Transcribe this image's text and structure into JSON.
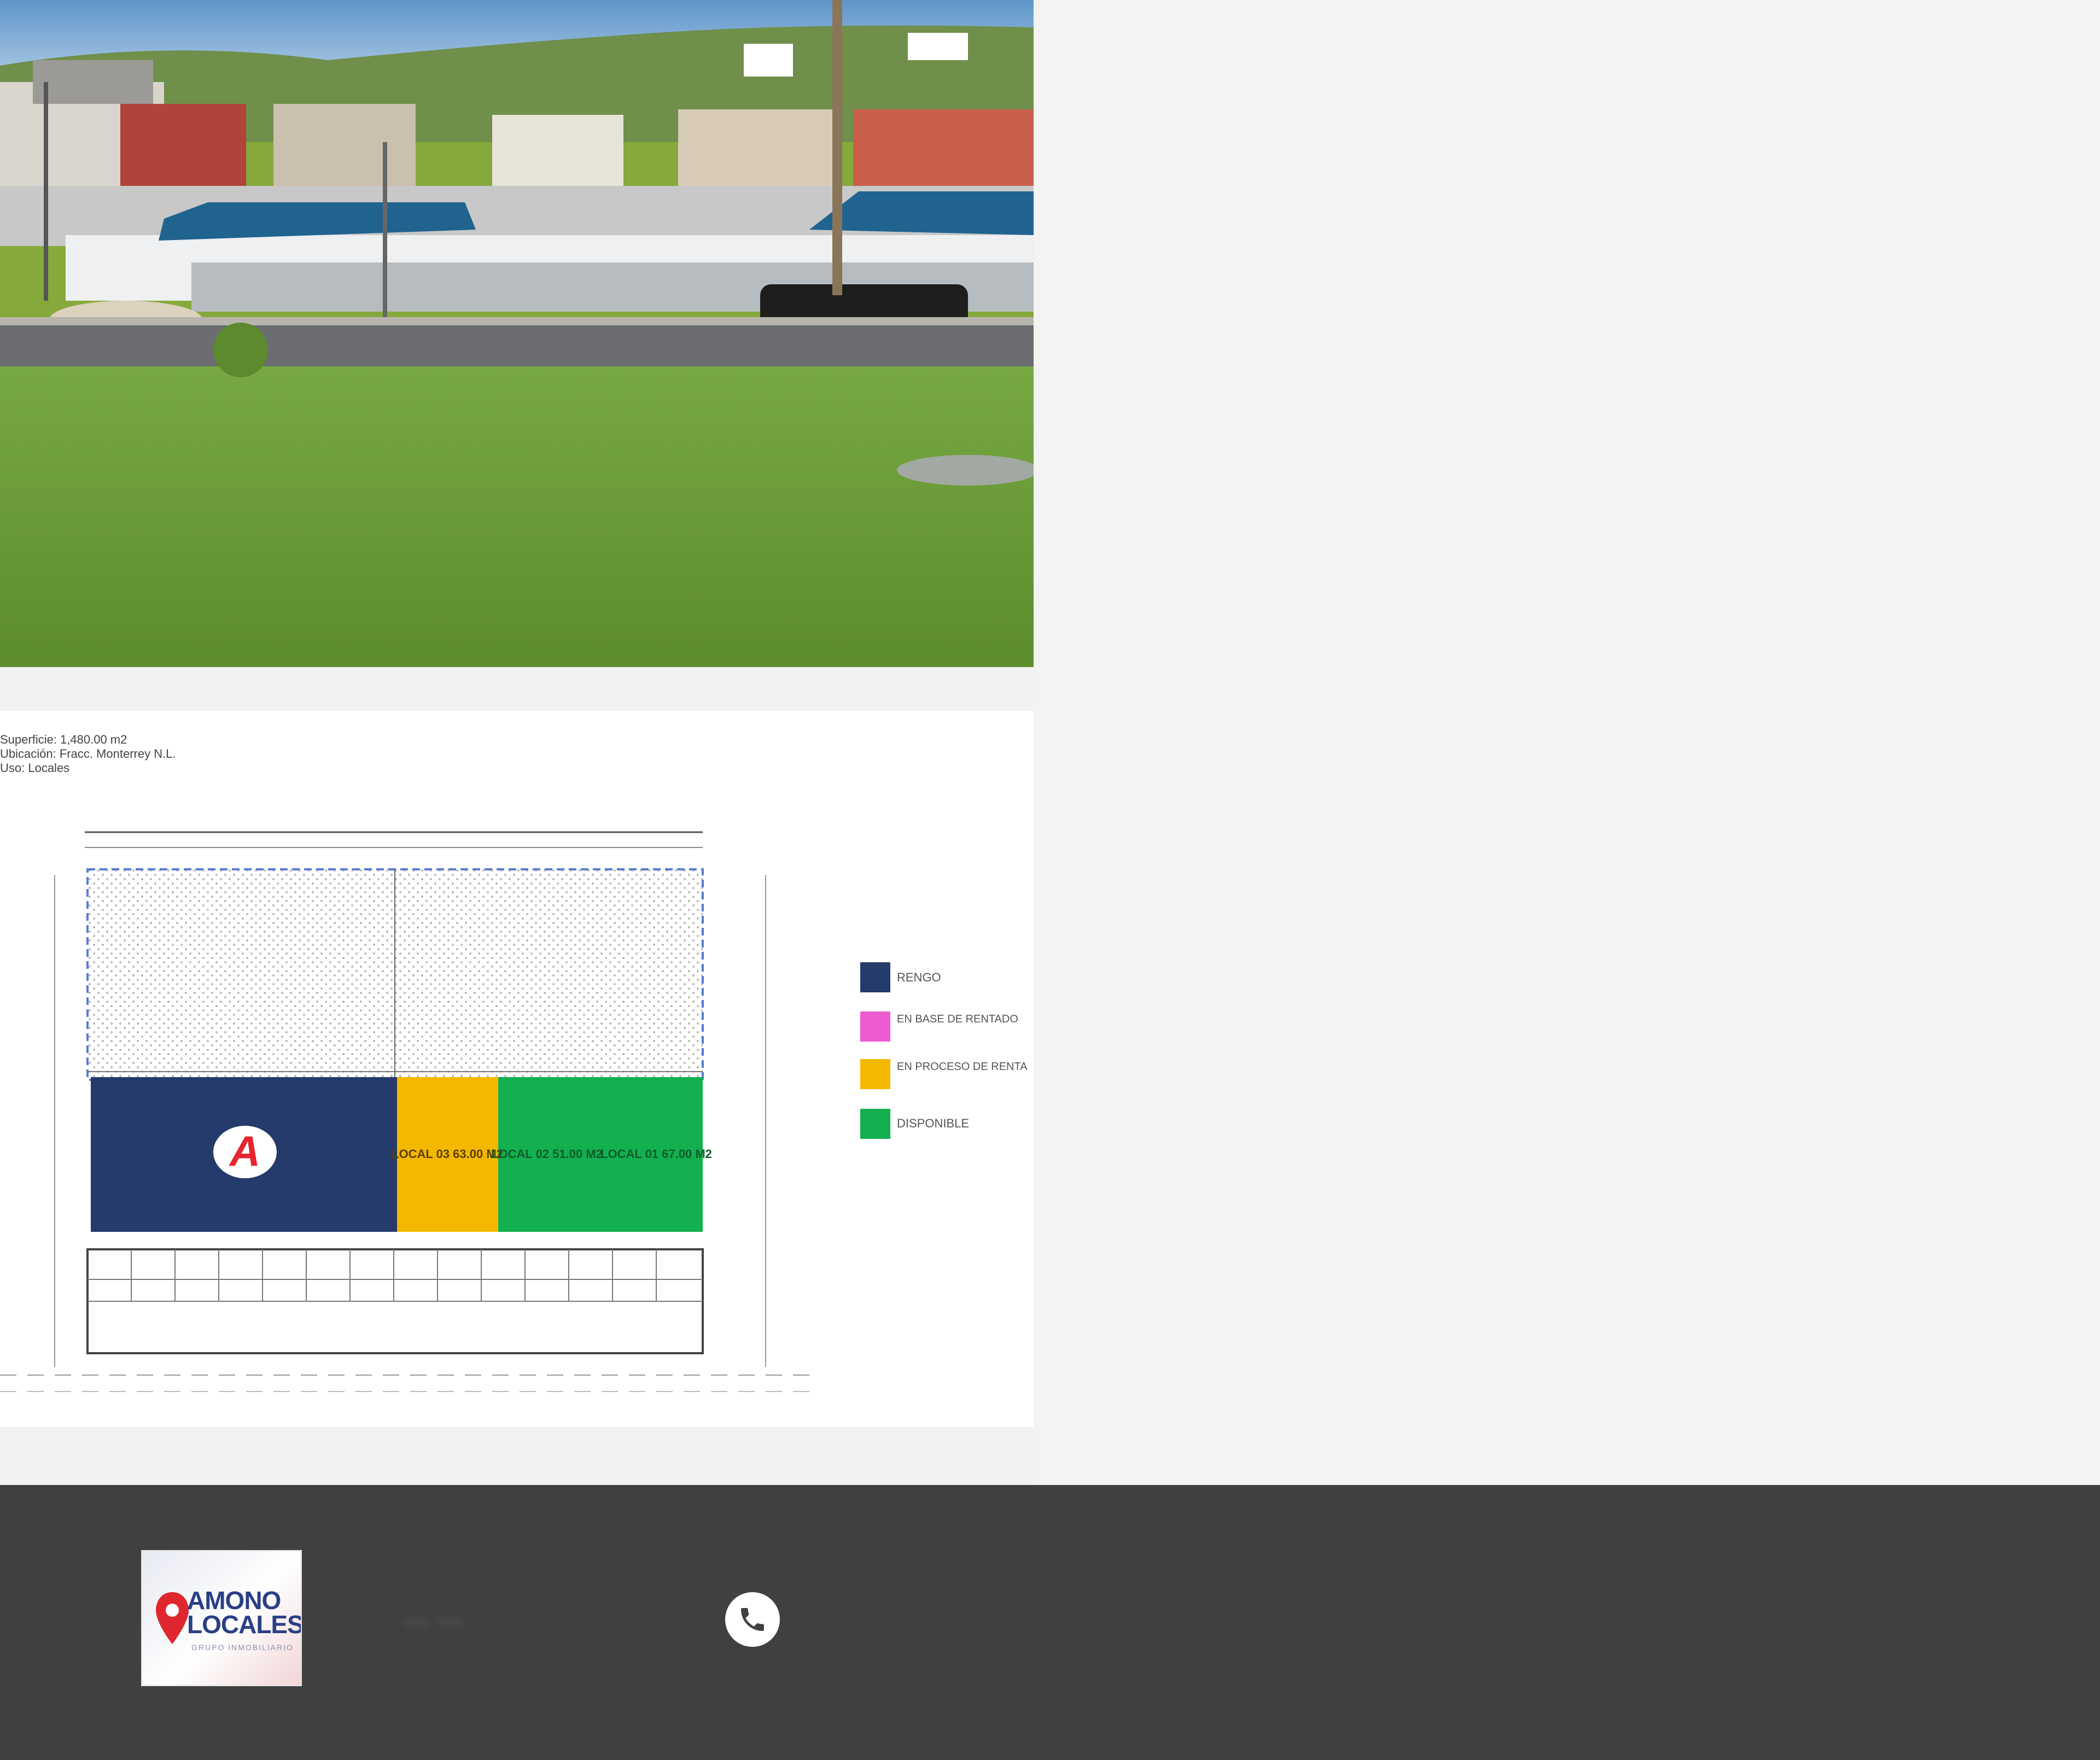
{
  "gallery": {
    "photo_alt": "Terreno con pasto frente a avenida",
    "plan_alt": "Plano del terreno"
  },
  "plan": {
    "legend": [
      {
        "label": "RENGO",
        "color": "#243b6b"
      },
      {
        "label": "EN BASE DE RENTADO",
        "color": "#ee5ad1"
      },
      {
        "label": "EN PROCESO DE RENTA",
        "color": "#f5b800"
      },
      {
        "label": "DISPONIBLE",
        "color": "#12b04f"
      }
    ],
    "lots": [
      {
        "label": "",
        "color": "#243b6b"
      },
      {
        "label": "LOCAL 03 63.00 M2",
        "color": "#f5b800"
      },
      {
        "label": "LOCAL 02 51.00 M2",
        "color": "#12b04f"
      },
      {
        "label": "LOCAL 01 67.00 M2",
        "color": "#12b04f"
      }
    ],
    "title_block": [
      "Superficie: 1,480.00 m2",
      "Ubicación: Fracc. Monterrey N.L.",
      "Uso: Locales"
    ]
  },
  "footer": {
    "logo_line1": "AMONO",
    "logo_line2": "LOCALES",
    "logo_sub": "GRUPO INMOBILIARIO",
    "contact_text": "... ..."
  }
}
